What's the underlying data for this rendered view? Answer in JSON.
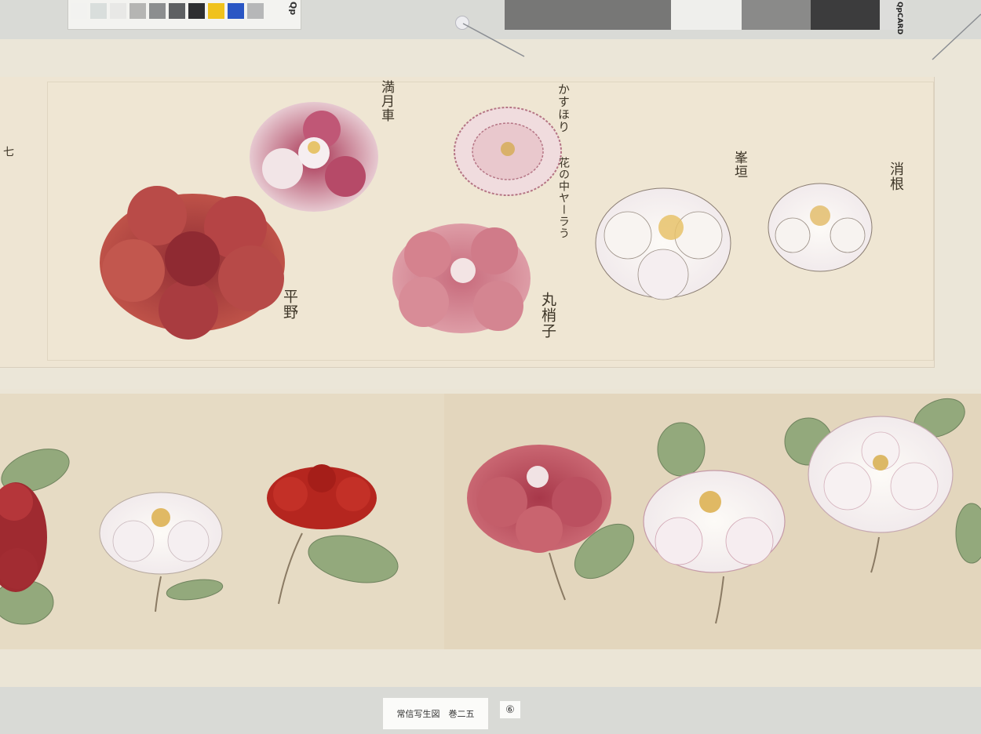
{
  "calibration": {
    "card_brand": "Qp",
    "gray_brand": "QpCARD",
    "swatch_colors": [
      "#f2f2f0",
      "#d9dedc",
      "#e8e8e6",
      "#b5b5b3",
      "#8c8e8f",
      "#5e6062",
      "#2e2f31",
      "#f0c21c",
      "#2a56c4",
      "#b6b7b8"
    ],
    "gray_steps": [
      "#777776",
      "#777776",
      "#efefec",
      "#8a8a89",
      "#3c3c3d",
      "#dddddb"
    ]
  },
  "labels": {
    "top_1": "満月車",
    "top_2": "平野",
    "top_3": "かすほり",
    "top_4": "花の中ヤーラう",
    "top_5": "丸梢子",
    "top_6": "峯垣",
    "top_7": "消根",
    "left_edge": "七"
  },
  "caption": {
    "title": "常信写生図　巻二五",
    "page_number": "⑥"
  },
  "colors": {
    "red_dark": "#a33a3c",
    "red_bright": "#b5261f",
    "pink": "#cf7d8a",
    "crimson": "#b5485a",
    "white_petal": "#f8f5f0",
    "leaf": "#8fa677"
  }
}
